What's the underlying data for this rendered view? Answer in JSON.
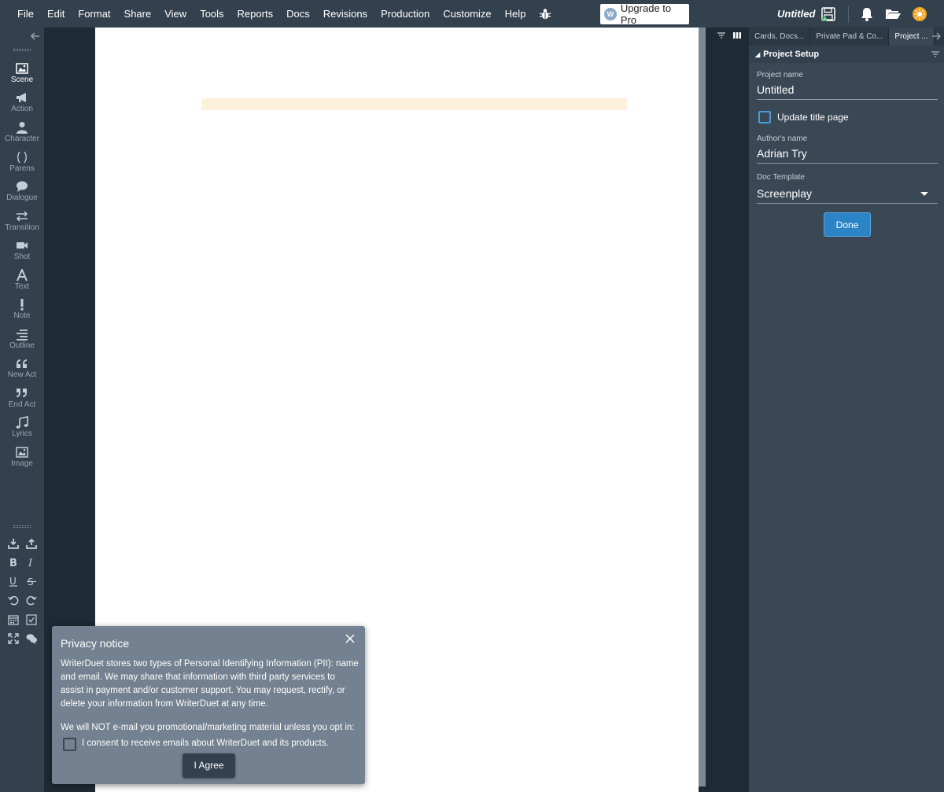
{
  "menu": {
    "items": [
      "File",
      "Edit",
      "Format",
      "Share",
      "View",
      "Tools",
      "Reports",
      "Docs",
      "Revisions",
      "Production",
      "Customize",
      "Help"
    ]
  },
  "header": {
    "upgrade_label": "Upgrade to Pro",
    "doc_title": "Untitled"
  },
  "tools": [
    {
      "label": "Scene",
      "icon": "image-icon"
    },
    {
      "label": "Action",
      "icon": "megaphone-icon"
    },
    {
      "label": "Character",
      "icon": "person-icon"
    },
    {
      "label": "Parens",
      "icon": "parens-icon"
    },
    {
      "label": "Dialogue",
      "icon": "speech-bubble-icon"
    },
    {
      "label": "Transition",
      "icon": "swap-arrows-icon"
    },
    {
      "label": "Shot",
      "icon": "video-camera-icon"
    },
    {
      "label": "Text",
      "icon": "letter-a-icon"
    },
    {
      "label": "Note",
      "icon": "exclamation-icon"
    },
    {
      "label": "Outline",
      "icon": "outline-icon"
    },
    {
      "label": "New Act",
      "icon": "quote-open-icon"
    },
    {
      "label": "End Act",
      "icon": "quote-close-icon"
    },
    {
      "label": "Lyrics",
      "icon": "music-note-icon"
    },
    {
      "label": "Image",
      "icon": "picture-icon"
    }
  ],
  "right_panel": {
    "tabs": [
      "Cards, Docs...",
      "Private Pad & Co...",
      "Project ..."
    ],
    "section_title": "Project Setup",
    "project_name_label": "Project name",
    "project_name_value": "Untitled",
    "update_title_label": "Update title page",
    "author_label": "Author's name",
    "author_value": "Adrian Try",
    "template_label": "Doc Template",
    "template_value": "Screenplay",
    "done_label": "Done"
  },
  "privacy": {
    "title": "Privacy notice",
    "body": "WriterDuet stores two types of Personal Identifying Information (PII): name and email. We may share that information with third party services to assist in payment and/or customer support. You may request, rectify, or delete your information from WriterDuet at any time.",
    "optin": "We will NOT e-mail you promotional/marketing material unless you opt in:",
    "consent": "I consent to receive emails about WriterDuet and its products.",
    "agree_label": "I Agree"
  },
  "colors": {
    "menubar": "#33414e",
    "accent": "#2b84c6",
    "scene_highlight": "#fdf0dc"
  }
}
